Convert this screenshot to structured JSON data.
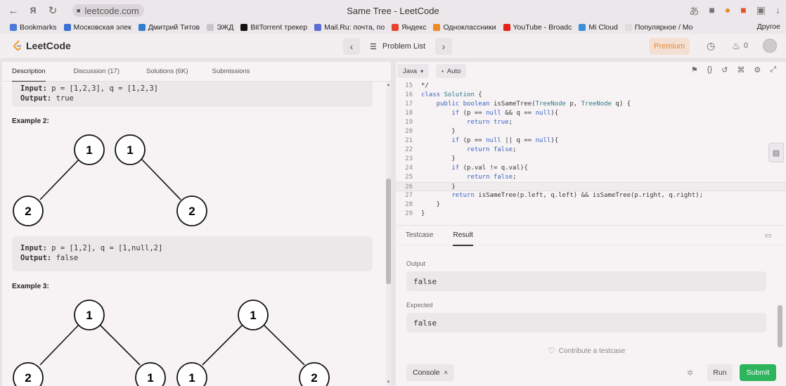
{
  "browser": {
    "address": "leetcode.com",
    "page_title": "Same Tree - LeetCode",
    "bookmarks": [
      {
        "label": "Bookmarks",
        "color": "#4a7bd6"
      },
      {
        "label": "Московская элек",
        "color": "#3a6fd8"
      },
      {
        "label": "Дмитрий Титов",
        "color": "#2f7fd1"
      },
      {
        "label": "ЭЖД",
        "color": "#c9c4c7"
      },
      {
        "label": "BitTorrent трекер",
        "color": "#111111"
      },
      {
        "label": "Mail.Ru: почта, по",
        "color": "#5b6bd1"
      },
      {
        "label": "Яндекс",
        "color": "#e8432e"
      },
      {
        "label": "Одноклассники",
        "color": "#f08a24"
      },
      {
        "label": "YouTube - Broadc",
        "color": "#e62117"
      },
      {
        "label": "Mi Cloud",
        "color": "#3a8fd8"
      },
      {
        "label": "Популярное / Mo",
        "color": "#dddddd"
      }
    ],
    "other_bookmarks": "Другое"
  },
  "header": {
    "logo": "LeetCode",
    "problem_list": "Problem List",
    "premium": "Premium",
    "streak_count": "0"
  },
  "left": {
    "tabs": [
      "Description",
      "Discussion (17)",
      "Solutions (6K)",
      "Submissions"
    ],
    "example1": {
      "input_label": "Input:",
      "input": "p = [1,2,3], q = [1,2,3]",
      "output_label": "Output:",
      "output": "true"
    },
    "example2": {
      "title": "Example 2:",
      "tree_p": {
        "root": "1",
        "left": "2"
      },
      "tree_q": {
        "root": "1",
        "right": "2"
      },
      "input_label": "Input:",
      "input": "p = [1,2], q = [1,null,2]",
      "output_label": "Output:",
      "output": "false"
    },
    "example3": {
      "title": "Example 3:",
      "tree_p": {
        "root": "1",
        "left": "2",
        "right": "1"
      },
      "tree_q": {
        "root": "1",
        "left": "1",
        "right": "2"
      }
    }
  },
  "editor": {
    "language": "Java",
    "mode": "Auto",
    "lines": [
      {
        "n": "15",
        "code": "*/"
      },
      {
        "n": "16",
        "code": "class Solution {"
      },
      {
        "n": "17",
        "code": "    public boolean isSameTree(TreeNode p, TreeNode q) {"
      },
      {
        "n": "18",
        "code": "        if (p == null && q == null){"
      },
      {
        "n": "19",
        "code": "            return true;"
      },
      {
        "n": "20",
        "code": "        }"
      },
      {
        "n": "21",
        "code": "        if (p == null || q == null){"
      },
      {
        "n": "22",
        "code": "            return false;"
      },
      {
        "n": "23",
        "code": "        }"
      },
      {
        "n": "24",
        "code": "        if (p.val != q.val){"
      },
      {
        "n": "25",
        "code": "            return false;"
      },
      {
        "n": "26",
        "code": "        }"
      },
      {
        "n": "27",
        "code": "        return isSameTree(p.left, q.left) && isSameTree(p.right, q.right);"
      },
      {
        "n": "28",
        "code": "    }"
      },
      {
        "n": "29",
        "code": "}"
      }
    ],
    "current_line": "26"
  },
  "result": {
    "tabs": [
      "Testcase",
      "Result"
    ],
    "output_label": "Output",
    "output_value": "false",
    "expected_label": "Expected",
    "expected_value": "false",
    "contribute": "Contribute a testcase",
    "console": "Console",
    "run": "Run",
    "submit": "Submit"
  },
  "colors": {
    "accent_green": "#2db55d",
    "premium_orange": "#e08b3c"
  }
}
